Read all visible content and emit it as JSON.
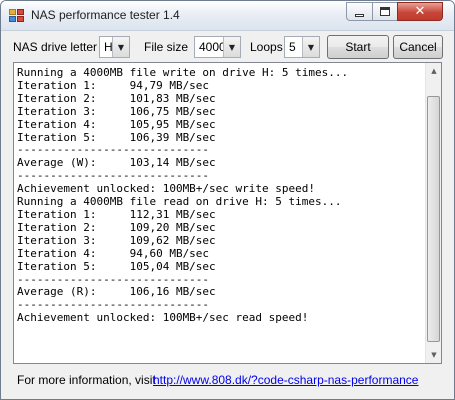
{
  "window": {
    "title": "NAS performance tester 1.4",
    "close_glyph": "✕"
  },
  "toolbar": {
    "drive_label": "NAS drive letter",
    "drive_value": "H",
    "filesize_label": "File size",
    "filesize_value": "4000",
    "loops_label": "Loops",
    "loops_value": "5",
    "dropdown_arrow": "▼",
    "start_label": "Start",
    "cancel_label": "Cancel"
  },
  "output": {
    "lines": [
      "Running a 4000MB file write on drive H: 5 times...",
      "Iteration 1:     94,79 MB/sec",
      "Iteration 2:     101,83 MB/sec",
      "Iteration 3:     106,75 MB/sec",
      "Iteration 4:     105,95 MB/sec",
      "Iteration 5:     106,39 MB/sec",
      "-----------------------------",
      "Average (W):     103,14 MB/sec",
      "-----------------------------",
      "Achievement unlocked: 100MB+/sec write speed!",
      "Running a 4000MB file read on drive H: 5 times...",
      "Iteration 1:     112,31 MB/sec",
      "Iteration 2:     109,20 MB/sec",
      "Iteration 3:     109,62 MB/sec",
      "Iteration 4:     94,60 MB/sec",
      "Iteration 5:     105,04 MB/sec",
      "-----------------------------",
      "Average (R):     106,16 MB/sec",
      "-----------------------------",
      "Achievement unlocked: 100MB+/sec read speed!",
      "",
      ""
    ],
    "scroll_up_glyph": "▲",
    "scroll_down_glyph": "▼"
  },
  "footer": {
    "text": "For more information, visit",
    "link": "http://www.808.dk/?code-csharp-nas-performance"
  }
}
